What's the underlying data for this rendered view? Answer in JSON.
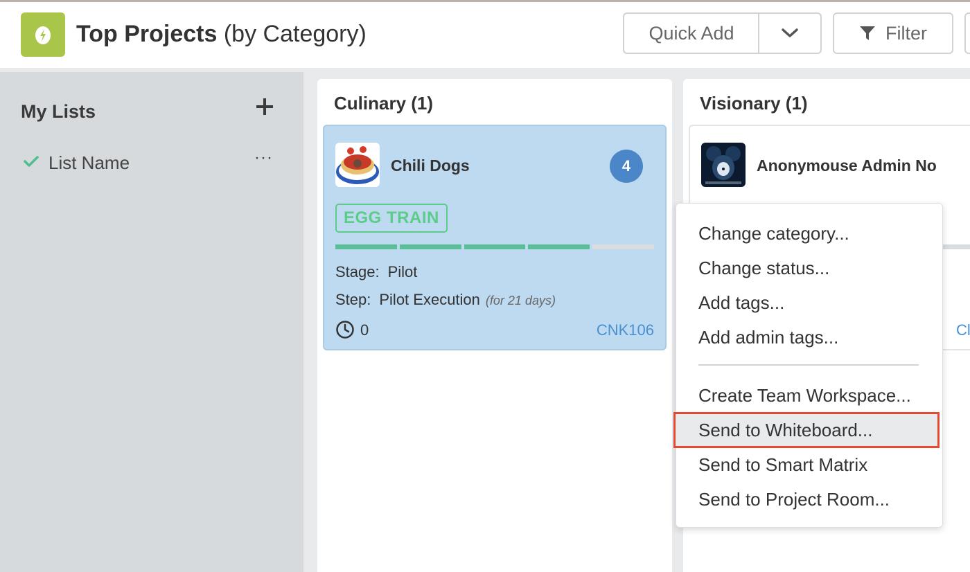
{
  "header": {
    "title_bold": "Top Projects",
    "title_rest": " (by Category)",
    "quick_add_label": "Quick Add",
    "filter_label": "Filter",
    "logo_color": "#aac64a"
  },
  "sidebar": {
    "title": "My Lists",
    "items": [
      {
        "label": "List Name",
        "more": "···"
      }
    ]
  },
  "columns": [
    {
      "title": "Culinary (1)",
      "cards": [
        {
          "name": "Chili Dogs",
          "badge": "4",
          "tag": "EGG TRAIN",
          "progress_steps_done": 4,
          "progress_steps_total": 5,
          "stage_label": "Stage:",
          "stage_value": "Pilot",
          "step_label": "Step:",
          "step_value": "Pilot Execution",
          "step_duration": "(for 21 days)",
          "clock_value": "0",
          "code": "CNK106"
        }
      ]
    },
    {
      "title": "Visionary (1)",
      "cards": [
        {
          "name": "Anonymouse Admin No",
          "code": "Cl"
        }
      ]
    }
  ],
  "context_menu": {
    "items": [
      "Change category...",
      "Change status...",
      "Add tags...",
      "Add admin tags...",
      "Create Team Workspace...",
      "Send to Whiteboard...",
      "Send to Smart Matrix",
      "Send to Project Room..."
    ],
    "highlighted_index": 5,
    "highlight_color": "#e24a32"
  },
  "colors": {
    "card_selected_bg": "#bedaf0",
    "badge": "#4a86c8",
    "tag_green": "#5dcb8a",
    "progress": "#5abf96",
    "link": "#4a90d2"
  }
}
